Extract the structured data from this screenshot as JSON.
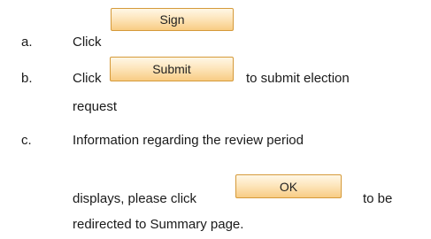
{
  "steps": [
    {
      "marker": "a.",
      "text": "Click",
      "button": "Sign"
    },
    {
      "marker": "b.",
      "text_before": "Click",
      "button": "Submit",
      "text_after": "to submit election",
      "text_cont": "request"
    },
    {
      "marker": "c.",
      "text_line1": "Information regarding the review period",
      "text_line2_before": "displays, please click",
      "button": "OK",
      "text_line2_after": "to be",
      "text_line3": "redirected to Summary page."
    }
  ]
}
